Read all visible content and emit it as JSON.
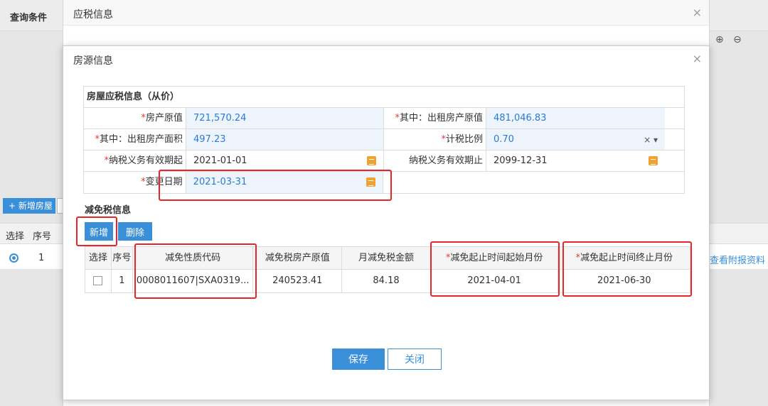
{
  "background": {
    "query_title": "查询条件",
    "add_house_label": "+ 新增房屋",
    "grid_headers": {
      "select": "选择",
      "seq": "序号"
    },
    "row_seq": "1",
    "link_text": "查看附报资料",
    "zoom_in": "⊕",
    "zoom_out": "⊖"
  },
  "outer_modal": {
    "title": "应税信息",
    "close": "×"
  },
  "inner_modal": {
    "title": "房源信息",
    "close": "×"
  },
  "tax_info": {
    "section_title": "房屋应税信息（从价）",
    "rows": [
      {
        "label1": "房产原值",
        "value1": "721,570.24",
        "label2": "其中：出租房产原值",
        "value2": "481,046.83"
      },
      {
        "label1": "其中：出租房产面积",
        "value1": "497.23",
        "label2": "计税比例",
        "value2": "0.70",
        "select_ctrl": "× ▾"
      },
      {
        "label1": "纳税义务有效期起",
        "value1": "2021-01-01",
        "label2": "纳税义务有效期止",
        "value2": "2099-12-31"
      },
      {
        "label1": "变更日期",
        "value1": "2021-03-31"
      }
    ]
  },
  "exemption": {
    "section_title": "减免税信息",
    "add_button": "新增",
    "delete_button": "删除",
    "headers": {
      "select": "选择",
      "seq": "序号",
      "code": "减免性质代码",
      "orig_value": "减免税房产原值",
      "monthly_amount": "月减免税金额",
      "start_month": "减免起止时间起始月份",
      "end_month": "减免起止时间终止月份"
    },
    "rows": [
      {
        "seq": "1",
        "code": "0008011607|SXA0319...",
        "orig_value": "240523.41",
        "monthly_amount": "84.18",
        "start_month": "2021-04-01",
        "end_month": "2021-06-30"
      }
    ]
  },
  "footer": {
    "save": "保存",
    "close": "关闭"
  },
  "required_mark": "*",
  "colors": {
    "accent": "#3a8fd9",
    "highlight": "#e8262a",
    "required": "#e4393c"
  }
}
